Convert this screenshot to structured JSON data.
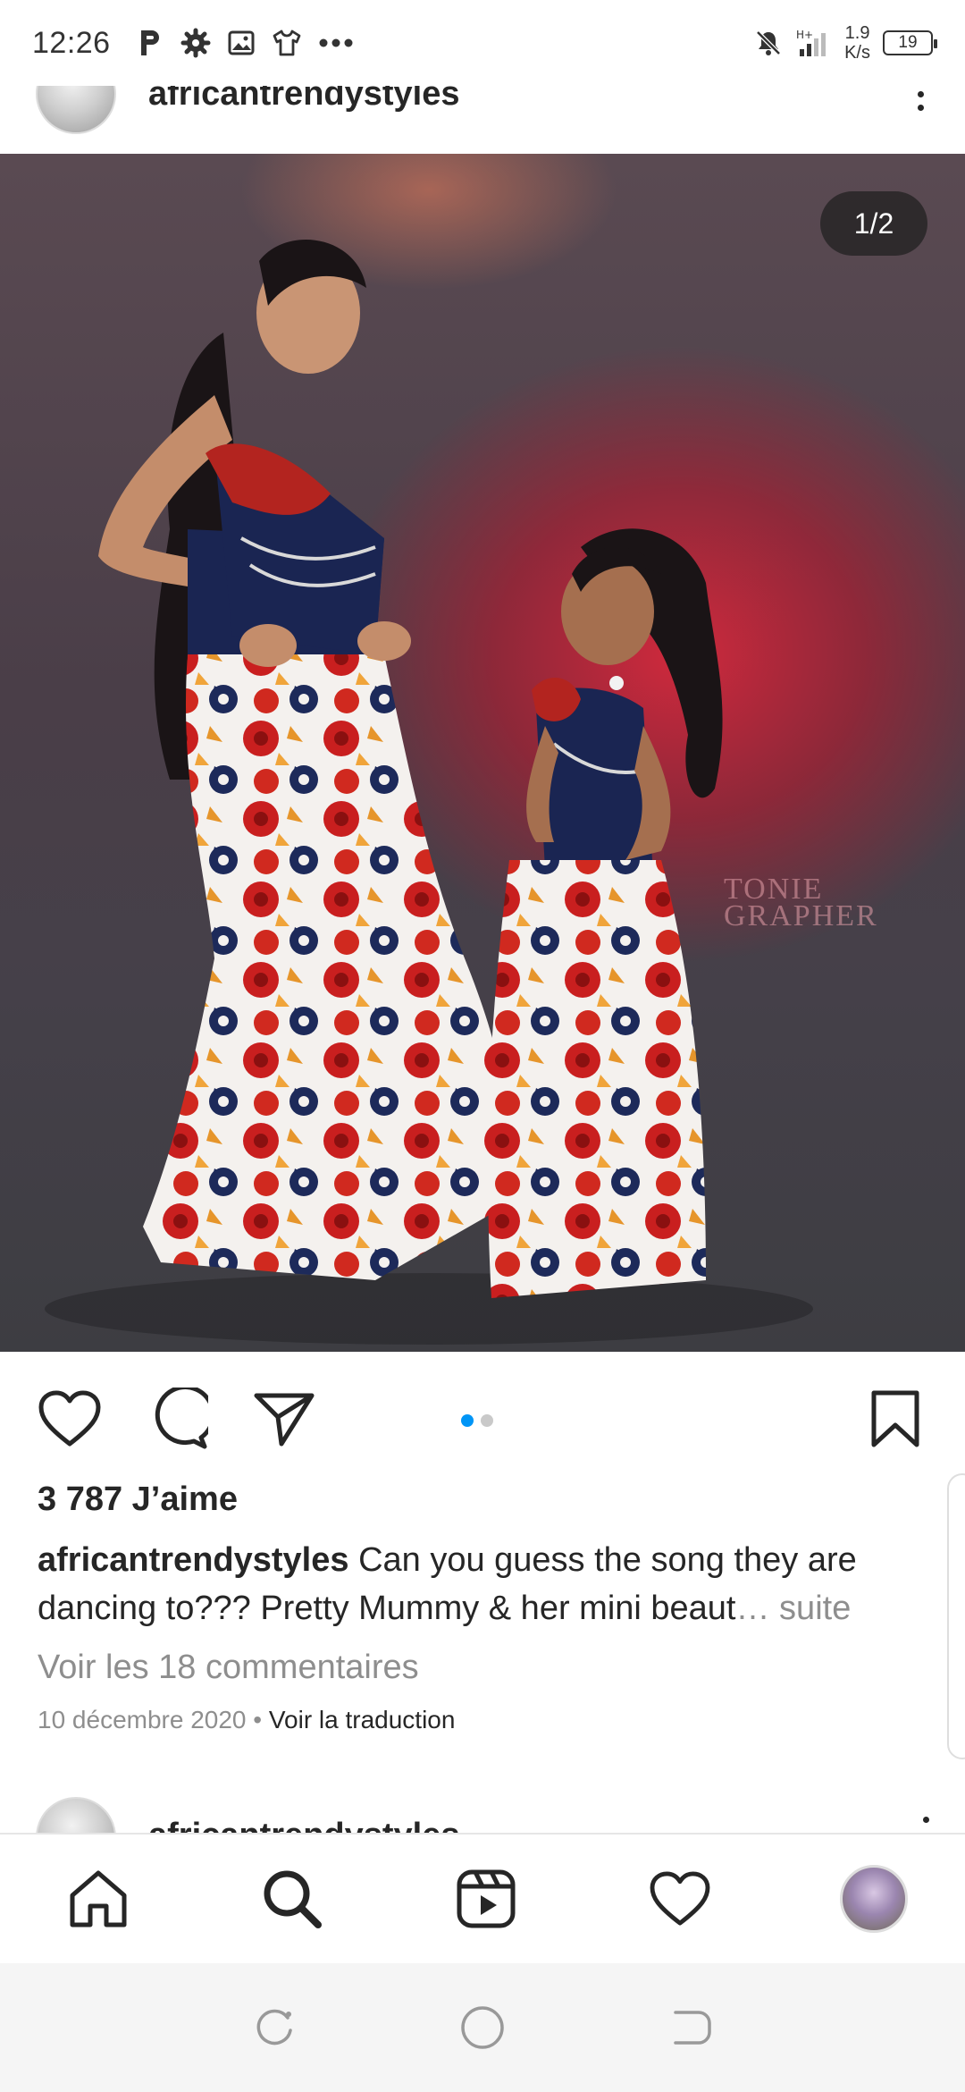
{
  "status_bar": {
    "time": "12:26",
    "left_icons": [
      "p-icon",
      "gear-icon",
      "gallery-icon",
      "shirt-icon",
      "more-horizontal-icon"
    ],
    "network_speed_value": "1.9",
    "network_speed_unit": "K/s",
    "battery_level": "19"
  },
  "post": {
    "author": "africantrendystyles",
    "image_counter": "1/2",
    "carousel_dots": 2,
    "carousel_active_index": 0,
    "watermark_line1": "TONIE",
    "watermark_line2": "GRAPHER",
    "likes": "3 787 J’aime",
    "caption_user": "africantrendystyles",
    "caption_text": "Can you guess the song they are dancing to??? Pretty Mummy & her mini beaut",
    "caption_more": "… suite",
    "comments_link": "Voir les 18 commentaires",
    "date": "10 décembre 2020",
    "separator": "•",
    "translate_link": "Voir la traduction"
  },
  "next_post": {
    "author": "africantrendystyles"
  },
  "colors": {
    "accent_blue": "#0095f6",
    "text": "#262626",
    "secondary_text": "#8e8e8e"
  },
  "bottom_nav": [
    "home-icon",
    "search-icon",
    "reels-icon",
    "heart-icon",
    "profile-avatar"
  ],
  "system_nav": [
    "recent-apps-icon",
    "home-circle-icon",
    "back-icon"
  ]
}
